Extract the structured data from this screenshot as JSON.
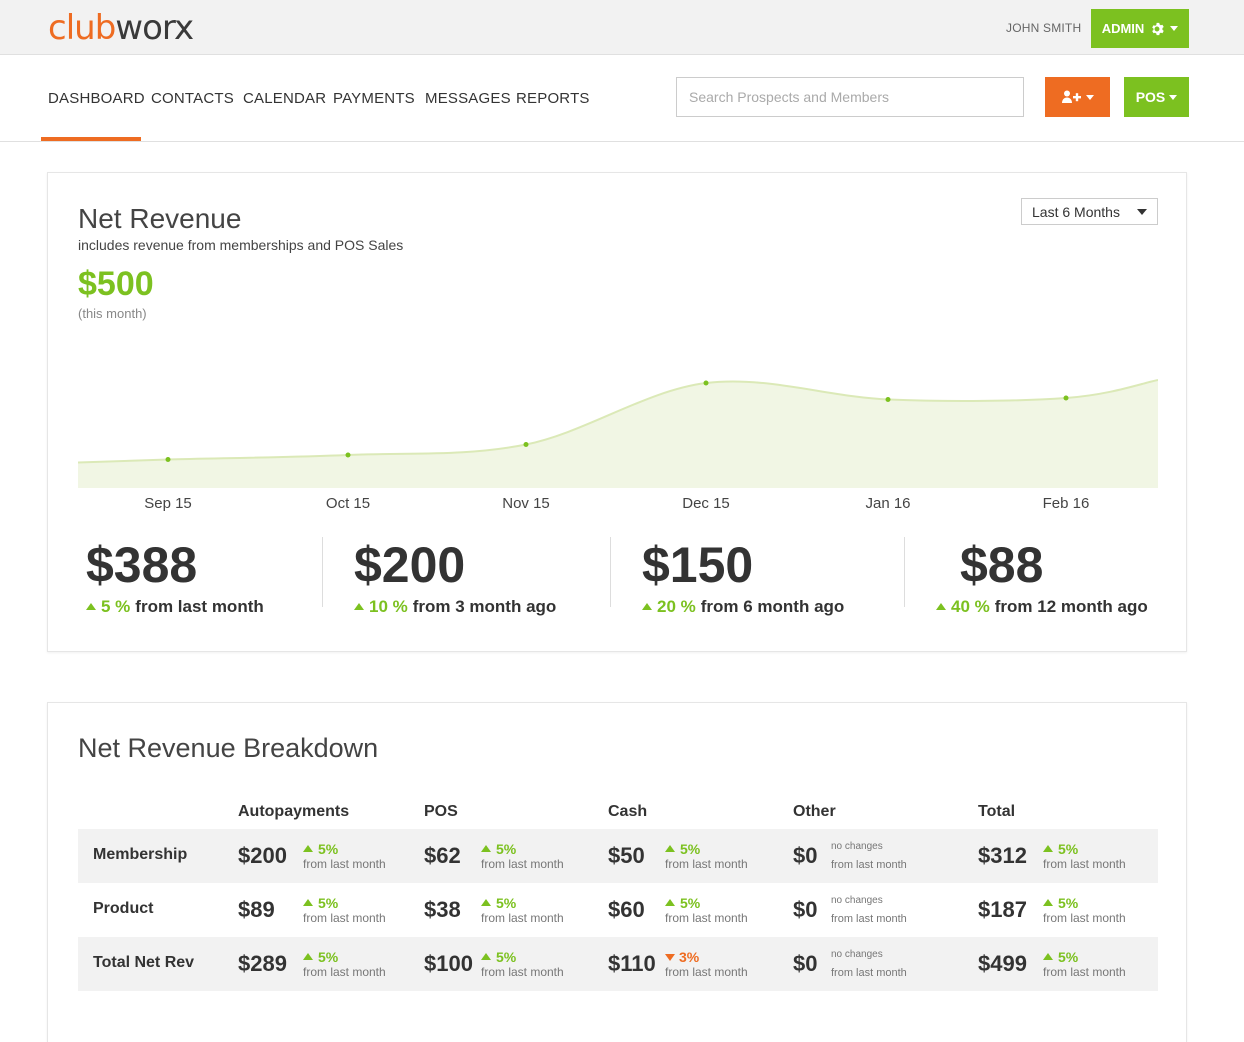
{
  "brand": {
    "logo_part1": "club",
    "logo_part2": "worx",
    "accent": "#ee6c22",
    "green": "#7cc120"
  },
  "user": {
    "name": "JOHN SMITH",
    "admin_label": "ADMIN"
  },
  "nav": {
    "items": [
      "DASHBOARD",
      "CONTACTS",
      "CALENDAR",
      "PAYMENTS",
      "MESSAGES",
      "REPORTS"
    ],
    "active": "DASHBOARD"
  },
  "search": {
    "placeholder": "Search Prospects and Members",
    "value": ""
  },
  "actions": {
    "add_icon": "add-user-icon",
    "pos_label": "POS"
  },
  "net_revenue": {
    "title": "Net Revenue",
    "subtitle": "includes revenue from memberships and POS Sales",
    "amount": "$500",
    "amount_note": "(this month)",
    "range": "Last 6 Months",
    "stats": [
      {
        "value": "$388",
        "pct": "5 %",
        "label": "from last month"
      },
      {
        "value": "$200",
        "pct": "10 %",
        "label": "from 3 month ago"
      },
      {
        "value": "$150",
        "pct": "20 %",
        "label": "from 6 month ago"
      },
      {
        "value": "$88",
        "pct": "40 %",
        "label": "from 12 month ago"
      }
    ]
  },
  "chart_data": {
    "type": "area",
    "categories": [
      "Sep 15",
      "Oct 15",
      "Nov 15",
      "Dec 15",
      "Jan 16",
      "Feb 16"
    ],
    "values": [
      19,
      22,
      29,
      70,
      59,
      60
    ],
    "ylim": [
      0,
      100
    ],
    "grid": false,
    "line_color": "#dbe9b7",
    "fill_color": "#f1f6e4",
    "point_color": "#7cc120"
  },
  "breakdown": {
    "title": "Net Revenue Breakdown",
    "columns": [
      "Autopayments",
      "POS",
      "Cash",
      "Other",
      "Total"
    ],
    "rows": [
      {
        "label": "Membership",
        "cells": [
          {
            "value": "$200",
            "change": "5%",
            "dir": "up",
            "note": "from last month"
          },
          {
            "value": "$62",
            "change": "5%",
            "dir": "up",
            "note": "from last month"
          },
          {
            "value": "$50",
            "change": "5%",
            "dir": "up",
            "note": "from last month"
          },
          {
            "value": "$0",
            "change": "no changes",
            "dir": "none",
            "note": "from last month"
          },
          {
            "value": "$312",
            "change": "5%",
            "dir": "up",
            "note": "from last month"
          }
        ]
      },
      {
        "label": "Product",
        "cells": [
          {
            "value": "$89",
            "change": "5%",
            "dir": "up",
            "note": "from last month"
          },
          {
            "value": "$38",
            "change": "5%",
            "dir": "up",
            "note": "from last month"
          },
          {
            "value": "$60",
            "change": "5%",
            "dir": "up",
            "note": "from last month"
          },
          {
            "value": "$0",
            "change": "no changes",
            "dir": "none",
            "note": "from last month"
          },
          {
            "value": "$187",
            "change": "5%",
            "dir": "up",
            "note": "from last month"
          }
        ]
      },
      {
        "label": "Total Net Rev",
        "cells": [
          {
            "value": "$289",
            "change": "5%",
            "dir": "up",
            "note": "from last month"
          },
          {
            "value": "$100",
            "change": "5%",
            "dir": "up",
            "note": "from last month"
          },
          {
            "value": "$110",
            "change": "3%",
            "dir": "down",
            "note": "from last month"
          },
          {
            "value": "$0",
            "change": "no changes",
            "dir": "none",
            "note": "from last month"
          },
          {
            "value": "$499",
            "change": "5%",
            "dir": "up",
            "note": "from last month"
          }
        ]
      }
    ]
  }
}
